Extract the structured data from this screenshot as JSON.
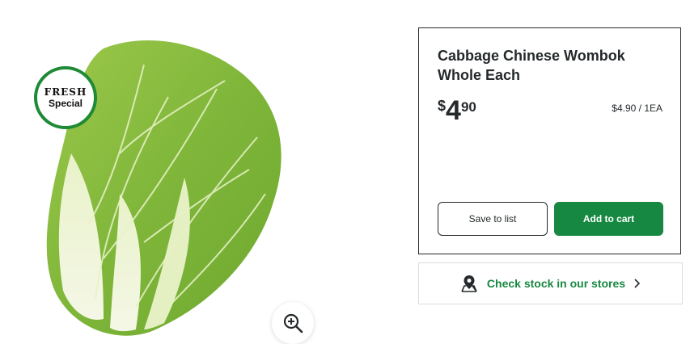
{
  "product": {
    "badge_line1": "FRESH",
    "badge_line2": "Special",
    "title": "Cabbage Chinese Wombok Whole Each",
    "price_currency": "$",
    "price_dollars": "4",
    "price_cents": "90",
    "unit_price": "$4.90 / 1EA"
  },
  "actions": {
    "save_label": "Save to list",
    "cart_label": "Add to cart"
  },
  "stock": {
    "label": "Check stock in our stores"
  },
  "icons": {
    "zoom": "zoom-in-icon",
    "location": "map-pin-icon",
    "chevron": "chevron-right-icon"
  },
  "colors": {
    "accent": "#178841",
    "text": "#25292b"
  }
}
